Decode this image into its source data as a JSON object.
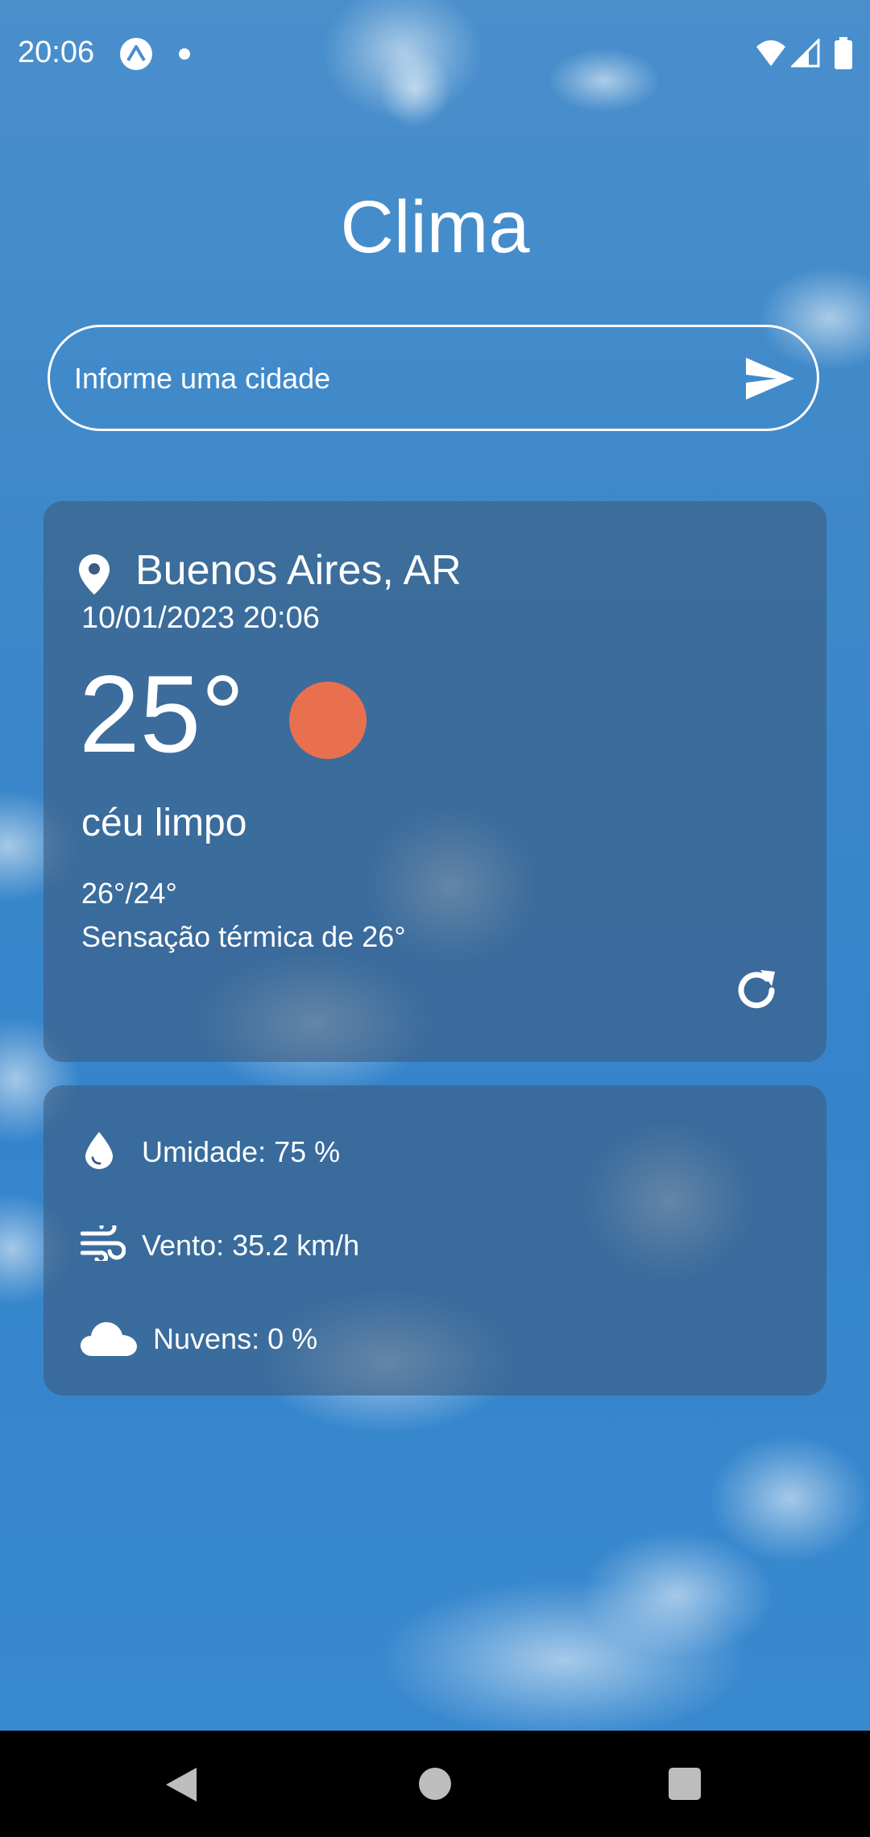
{
  "status_bar": {
    "time": "20:06",
    "app_icon": "expo-icon",
    "notification_dot": "dot-icon",
    "wifi": "wifi-icon",
    "signal": "signal-icon",
    "battery": "battery-icon"
  },
  "header": {
    "title": "Clima"
  },
  "search": {
    "placeholder": "Informe uma cidade",
    "value": "",
    "send_icon": "send-icon"
  },
  "weather": {
    "location_icon": "location-pin-icon",
    "location": "Buenos Aires, AR",
    "datetime": "10/01/2023 20:06",
    "temperature": "25°",
    "condition_icon": "sun-icon",
    "condition": "céu limpo",
    "min_max": "26°/24°",
    "feels_like": "Sensação térmica de 26°",
    "refresh_icon": "refresh-icon"
  },
  "details": {
    "humidity": {
      "icon": "droplet-icon",
      "text": "Umidade: 75 %"
    },
    "wind": {
      "icon": "wind-icon",
      "text": "Vento: 35.2 km/h"
    },
    "clouds": {
      "icon": "cloud-icon",
      "text": "Nuvens: 0 %"
    }
  },
  "colors": {
    "sky": "#3d88c9",
    "card": "#3c5c80",
    "sun": "#e8704f",
    "text": "#ffffff",
    "nav_bar": "#000000"
  },
  "nav_bar": {
    "back": "back-triangle-icon",
    "home": "home-circle-icon",
    "recents": "recents-square-icon"
  }
}
